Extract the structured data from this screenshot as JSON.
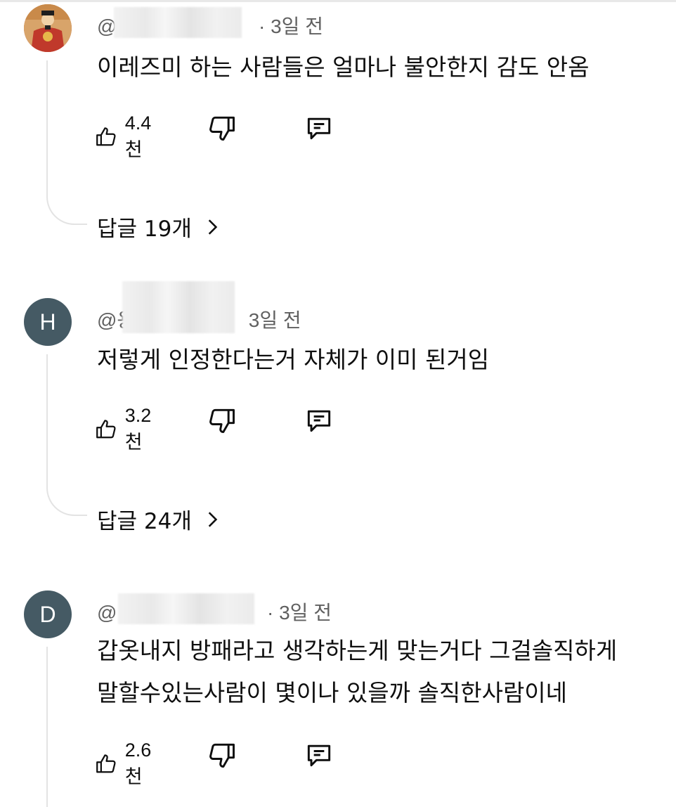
{
  "comments": [
    {
      "author_prefix": "@",
      "time": "3일 전",
      "avatar_letter": "",
      "avatar_color": "#c0392b",
      "text_lines": [
        "이레즈미 하는 사람들은 얼마나 불안한지 감도 안옴"
      ],
      "likes": "4.4천",
      "replies_label": "답글 19개"
    },
    {
      "author_prefix": "@용",
      "time": "3일 전",
      "avatar_letter": "H",
      "avatar_color": "#455a64",
      "text_lines": [
        "저렇게 인정한다는거 자체가 이미 된거임"
      ],
      "likes": "3.2천",
      "replies_label": "답글 24개"
    },
    {
      "author_prefix": "@",
      "time": "3일 전",
      "avatar_letter": "D",
      "avatar_color": "#455a64",
      "text_lines": [
        "갑옷내지 방패라고 생각하는게 맞는거다 그걸솔직하게",
        "말할수있는사람이 몇이나 있을까 솔직한사람이네"
      ],
      "likes": "2.6천",
      "replies_label": ""
    }
  ],
  "icons": {
    "like": "thumbs-up-icon",
    "dislike": "thumbs-down-icon",
    "reply": "comment-icon",
    "chevron": "chevron-right-icon"
  }
}
